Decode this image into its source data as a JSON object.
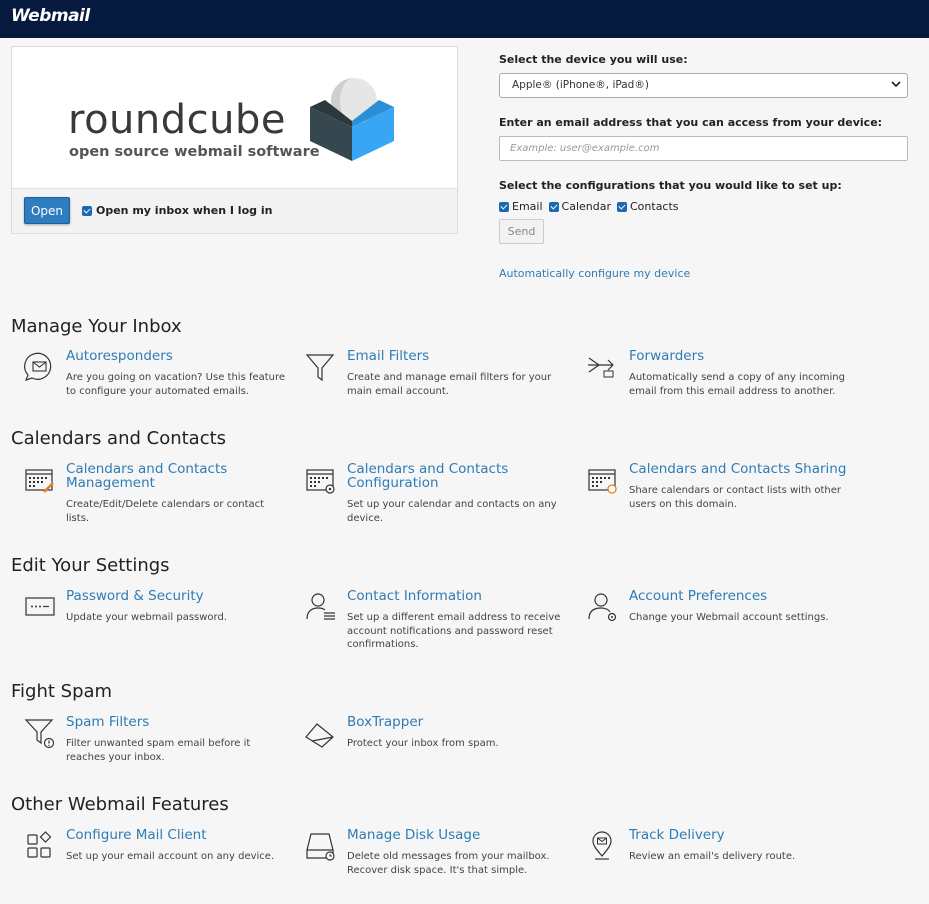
{
  "header": {
    "brand": "Webmail"
  },
  "roundcube": {
    "logo_word": "roundcube",
    "logo_sub": "open source webmail software",
    "open_label": "Open",
    "open_inbox_label": "Open my inbox when I log in"
  },
  "device": {
    "select_label": "Select the device you will use:",
    "select_value": "Apple® (iPhone®, iPad®)",
    "email_label": "Enter an email address that you can access from your device:",
    "email_placeholder": "Example: user@example.com",
    "configs_label": "Select the configurations that you would like to set up:",
    "configs": [
      "Email",
      "Calendar",
      "Contacts"
    ],
    "send_label": "Send",
    "auto_link": "Automatically configure my device"
  },
  "sections": [
    {
      "title": "Manage Your Inbox",
      "items": [
        {
          "title": "Autoresponders",
          "desc": "Are you going on vacation? Use this feature to configure your automated emails.",
          "icon": "autoresponder-icon"
        },
        {
          "title": "Email Filters",
          "desc": "Create and manage email filters for your main email account.",
          "icon": "filter-icon"
        },
        {
          "title": "Forwarders",
          "desc": "Automatically send a copy of any incoming email from this email address to another.",
          "icon": "forward-icon"
        }
      ]
    },
    {
      "title": "Calendars and Contacts",
      "items": [
        {
          "title": "Calendars and Contacts Management",
          "desc": "Create/Edit/Delete calendars or contact lists.",
          "icon": "calendar-edit-icon"
        },
        {
          "title": "Calendars and Contacts Configuration",
          "desc": "Set up your calendar and contacts on any device.",
          "icon": "calendar-config-icon"
        },
        {
          "title": "Calendars and Contacts Sharing",
          "desc": "Share calendars or contact lists with other users on this domain.",
          "icon": "calendar-share-icon"
        }
      ]
    },
    {
      "title": "Edit Your Settings",
      "items": [
        {
          "title": "Password & Security",
          "desc": "Update your webmail password.",
          "icon": "password-icon"
        },
        {
          "title": "Contact Information",
          "desc": "Set up a different email address to receive account notifications and password reset confirmations.",
          "icon": "contact-info-icon"
        },
        {
          "title": "Account Preferences",
          "desc": "Change your Webmail account settings.",
          "icon": "account-prefs-icon"
        }
      ]
    },
    {
      "title": "Fight Spam",
      "items": [
        {
          "title": "Spam Filters",
          "desc": "Filter unwanted spam email before it reaches your inbox.",
          "icon": "spam-filter-icon"
        },
        {
          "title": "BoxTrapper",
          "desc": "Protect your inbox from spam.",
          "icon": "boxtrapper-icon"
        }
      ]
    },
    {
      "title": "Other Webmail Features",
      "items": [
        {
          "title": "Configure Mail Client",
          "desc": "Set up your email account on any device.",
          "icon": "mail-client-icon"
        },
        {
          "title": "Manage Disk Usage",
          "desc": "Delete old messages from your mailbox. Recover disk space. It's that simple.",
          "icon": "disk-usage-icon"
        },
        {
          "title": "Track Delivery",
          "desc": "Review an email's delivery route.",
          "icon": "track-delivery-icon"
        }
      ]
    }
  ]
}
